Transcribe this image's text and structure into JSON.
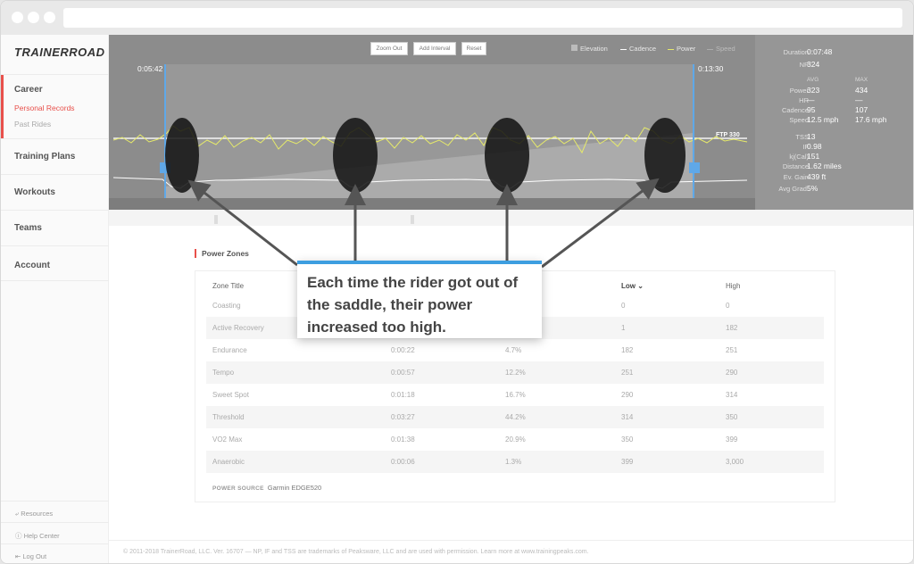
{
  "app": {
    "logo": "TRAINERROAD"
  },
  "sidebar": {
    "career": {
      "label": "Career",
      "subs": [
        "Personal Records",
        "Past Rides"
      ]
    },
    "items": [
      "Training Plans",
      "Workouts",
      "Teams",
      "Account"
    ],
    "footer": [
      "Resources",
      "Help Center",
      "Log Out"
    ]
  },
  "chart": {
    "buttons": [
      "Zoom Out",
      "Add Interval",
      "Reset"
    ],
    "legend": [
      "Elevation",
      "Cadence",
      "Power",
      "Speed"
    ],
    "range_start": "0:05:42",
    "range_end": "0:13:30",
    "ftp_label": "FTP 330",
    "colors": {
      "power": "#e6ea6a",
      "cadence": "#ffffff",
      "marker": "#5fa8e8",
      "background": "#8c8c8c"
    }
  },
  "stats": {
    "duration_label": "Duration",
    "duration": "0:07:48",
    "np_label": "NP",
    "np": "324",
    "avg_head": "AVG",
    "max_head": "MAX",
    "rows": [
      {
        "label": "Power",
        "avg": "323",
        "max": "434"
      },
      {
        "label": "HR",
        "avg": "—",
        "max": "—"
      },
      {
        "label": "Cadence",
        "avg": "95",
        "max": "107"
      },
      {
        "label": "Speed",
        "avg": "12.5 mph",
        "max": "17.6 mph"
      }
    ],
    "extra": [
      {
        "label": "TSS",
        "value": "13"
      },
      {
        "label": "IF",
        "value": "0.98"
      },
      {
        "label": "kj(Cal)",
        "value": "151"
      },
      {
        "label": "Distance",
        "value": "1.62 miles"
      },
      {
        "label": "Ev. Gain",
        "value": "439 ft"
      },
      {
        "label": "Avg Grad.",
        "value": "5%"
      }
    ]
  },
  "power_zones": {
    "title": "Power Zones",
    "headers": [
      "Zone Title",
      "Low ⌄",
      "High"
    ],
    "rows": [
      {
        "zone": "Coasting",
        "time": "",
        "pct": "",
        "low": "0",
        "high": "0"
      },
      {
        "zone": "Active Recovery",
        "time": "",
        "pct": "",
        "low": "1",
        "high": "182"
      },
      {
        "zone": "Endurance",
        "time": "0:00:22",
        "pct": "4.7%",
        "low": "182",
        "high": "251"
      },
      {
        "zone": "Tempo",
        "time": "0:00:57",
        "pct": "12.2%",
        "low": "251",
        "high": "290"
      },
      {
        "zone": "Sweet Spot",
        "time": "0:01:18",
        "pct": "16.7%",
        "low": "290",
        "high": "314"
      },
      {
        "zone": "Threshold",
        "time": "0:03:27",
        "pct": "44.2%",
        "low": "314",
        "high": "350"
      },
      {
        "zone": "VO2 Max",
        "time": "0:01:38",
        "pct": "20.9%",
        "low": "350",
        "high": "399"
      },
      {
        "zone": "Anaerobic",
        "time": "0:00:06",
        "pct": "1.3%",
        "low": "399",
        "high": "3,000"
      }
    ],
    "power_source_label": "POWER SOURCE",
    "power_source": "Garmin EDGE520"
  },
  "callout": {
    "text": "Each time the rider got out of the saddle, their power increased too high."
  },
  "footer": "© 2011-2018 TrainerRoad, LLC. Ver. 16707 — NP, IF and TSS are trademarks of Peaksware, LLC and are used with permission. Learn more at www.trainingpeaks.com."
}
